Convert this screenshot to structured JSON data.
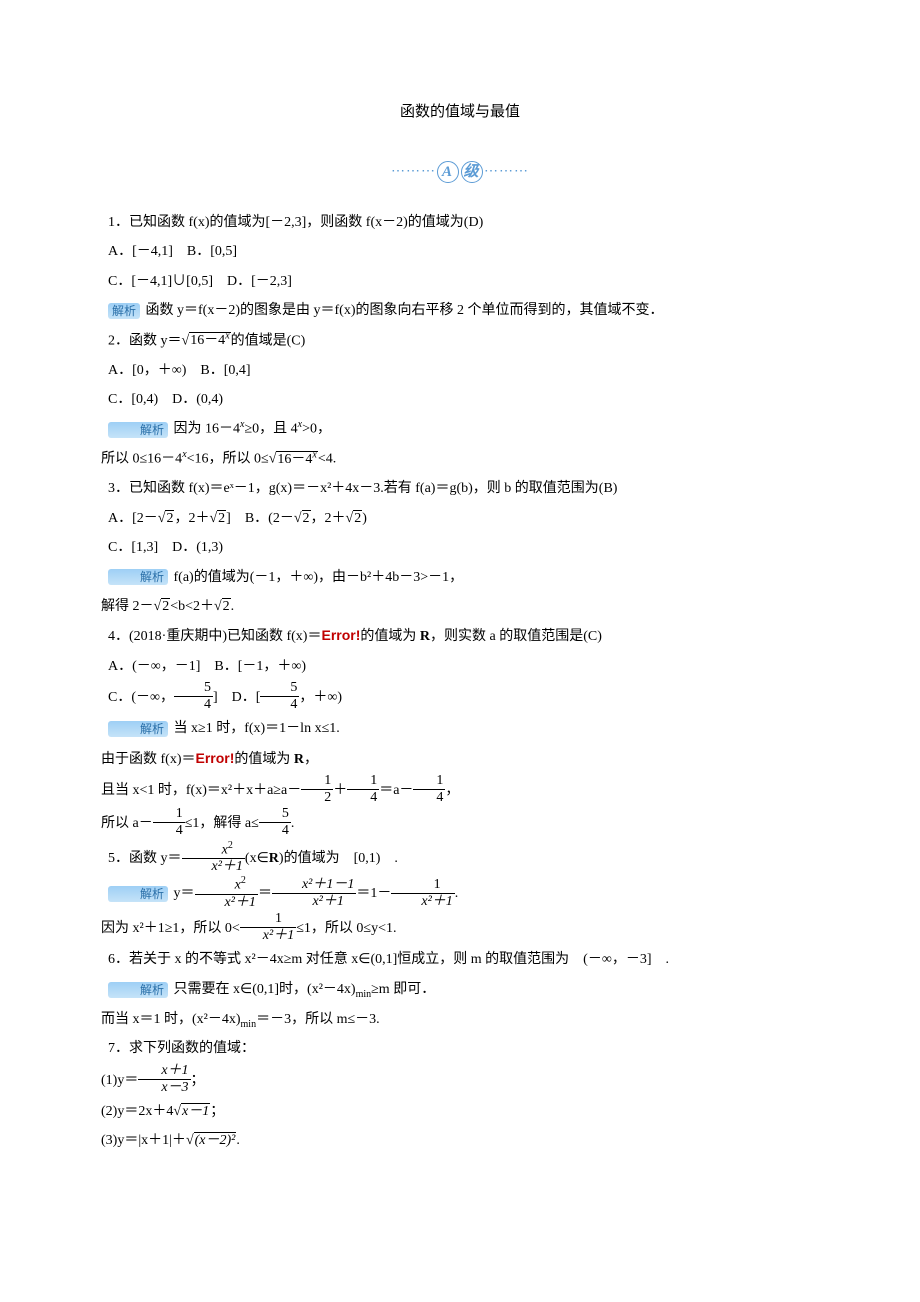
{
  "title": "函数的值域与最值",
  "badge": {
    "left": "⋯⋯⋯",
    "c1": "A",
    "c2": "级",
    "right": "⋯⋯⋯"
  },
  "q1": {
    "stem": "1．已知函数 f(x)的值域为[－2,3]，则函数 f(x－2)的值域为(D)",
    "a": "A．[－4,1]　B．[0,5]",
    "c": "C．[－4,1]∪[0,5]　D．[－2,3]",
    "ans_label": "解析",
    "ans": " 函数 y＝f(x－2)的图象是由 y＝f(x)的图象向右平移 2 个单位而得到的，其值域不变．"
  },
  "q2": {
    "stem_pre": "2．函数 y＝",
    "rad": "16－4",
    "rad_sup": "x",
    "stem_post": "的值域是(C)",
    "a": "A．[0，＋∞)　B．[0,4]",
    "c": "C．[0,4)　D．(0,4)",
    "ans_label": "解析",
    "ans1_pre": " 因为 16－4",
    "ans1_mid": "≥0，且 4",
    "ans1_post": ">0，",
    "ans2_pre": "所以 0≤16－4",
    "ans2_mid": "<16，所以 0≤",
    "ans2_rad": "16－4",
    "ans2_post": "<4."
  },
  "q3": {
    "stem": "3．已知函数 f(x)＝eˣ－1，g(x)＝－x²＋4x－3.若有 f(a)＝g(b)，则 b 的取值范围为(B)",
    "a_pre": "A．[2－",
    "a_mid": "，2＋",
    "a_post": "]　B．(2－",
    "a_mid2": "，2＋",
    "a_end": ")",
    "radv": "2",
    "c": "C．[1,3]　D．(1,3)",
    "ans_label": "解析",
    "ans1": " f(a)的值域为(－1，＋∞)，由－b²＋4b－3>－1，",
    "ans2_pre": "解得 2－",
    "ans2_mid": "<b<2＋",
    "ans2_post": "."
  },
  "q4": {
    "stem_pre": "4．(2018·重庆期中)已知函数 f(x)＝",
    "err": "Error!",
    "stem_post": "的值域为 ",
    "R": "R",
    "stem_end": "，则实数 a 的取值范围是(C)",
    "a": "A．(－∞，－1]　B．[－1，＋∞)",
    "c_pre": "C．(－∞，",
    "c_mid": "]　D．[",
    "c_post": "，＋∞)",
    "frac_num": "5",
    "frac_den": "4",
    "ans_label": "解析",
    "ans1": " 当 x≥1 时，f(x)＝1－ln x≤1.",
    "ans2_pre": "由于函数 f(x)＝",
    "ans2_post": "的值域为 ",
    "ans3_pre": "且当 x<1 时，f(x)＝x²＋x＋a≥a－",
    "tfrac12n": "1",
    "tfrac12d": "2",
    "ans3_mid": "＋",
    "tfrac14n": "1",
    "tfrac14d": "4",
    "ans3_mid2": "＝a－",
    "ans3_post": "，",
    "ans4_pre": "所以 a－",
    "ans4_mid": "≤1，解得 a≤",
    "ans4_post": "."
  },
  "q5": {
    "stem_pre": "5．函数 y＝",
    "frac_num_n": "x",
    "frac_num_e": "2",
    "frac_den": "x²＋1",
    "stem_post": "(x∈",
    "R": "R",
    "stem_end": ")的值域为　[0,1)　.",
    "ans_label": "解析",
    "eq_pre": " y＝",
    "eq_mid1": "＝",
    "frac2_num": "x²＋1－1",
    "eq_mid2": "＝1－",
    "frac3_num": "1",
    "eq_post": ".",
    "bound_pre": "因为 x²＋1≥1，所以 0<",
    "bound_post": "≤1，所以 0≤y<1."
  },
  "q6": {
    "stem": "6．若关于 x 的不等式 x²－4x≥m 对任意 x∈(0,1]恒成立，则 m 的取值范围为　(－∞，－3]　.",
    "ans_label": "解析",
    "ans1_pre": " 只需要在 x∈(0,1]时，(x²－4x)",
    "min": "min",
    "ans1_post": "≥m 即可．",
    "ans2_pre": "而当 x＝1 时，(x²－4x)",
    "ans2_post": "＝－3，所以 m≤－3."
  },
  "q7": {
    "stem": "7．求下列函数的值域：",
    "p1_pre": "(1)y＝",
    "p1_num": "x＋1",
    "p1_den": "x－3",
    "p1_post": "；",
    "p2_pre": "(2)y＝2x＋4",
    "p2_rad": "x－1",
    "p2_post": "；",
    "p3_pre": "(3)y＝|x＋1|＋",
    "p3_rad": "(x－2)²",
    "p3_post": "."
  }
}
